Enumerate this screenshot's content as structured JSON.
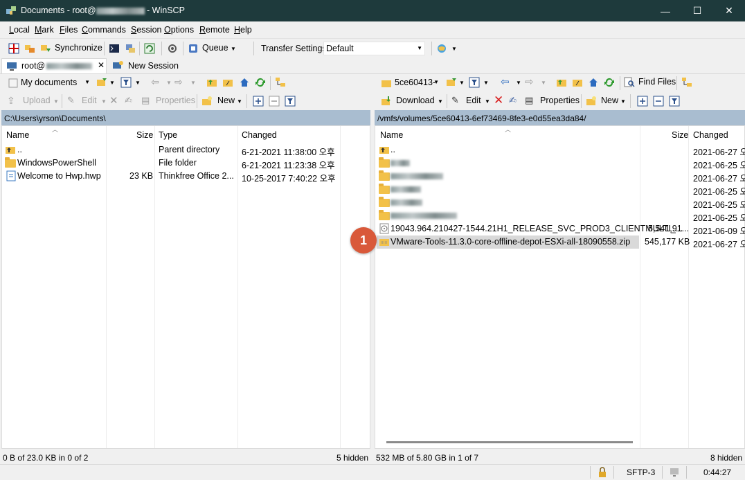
{
  "window": {
    "title_prefix": "Documents - root@",
    "title_suffix": " - WinSCP",
    "minimize_glyph": "—",
    "maximize_glyph": "☐",
    "close_glyph": "✕"
  },
  "menu": {
    "items": [
      {
        "underline": "L",
        "rest": "ocal"
      },
      {
        "underline": "M",
        "rest": "ark"
      },
      {
        "underline": "F",
        "rest": "iles"
      },
      {
        "underline": "C",
        "rest": "ommands"
      },
      {
        "underline": "S",
        "rest": "ession"
      },
      {
        "underline": "O",
        "rest": "ptions"
      },
      {
        "underline": "R",
        "rest": "emote"
      },
      {
        "underline": "H",
        "rest": "elp"
      }
    ]
  },
  "toolbar": {
    "synchronize_label": "Synchronize",
    "queue_label": "Queue",
    "transfer_settings_label": "Transfer Settings",
    "transfer_settings_value": "Default"
  },
  "tabs": {
    "session_tab_prefix": "root@",
    "new_session_label": "New Session"
  },
  "left_panel": {
    "location_combo": "My documents",
    "upload_label": "Upload",
    "edit_label": "Edit",
    "properties_label": "Properties",
    "new_label": "New",
    "path": "C:\\Users\\yrson\\Documents\\",
    "columns": {
      "name": "Name",
      "size": "Size",
      "type": "Type",
      "changed": "Changed"
    },
    "rows": [
      {
        "name": "..",
        "size": "",
        "type": "Parent directory",
        "changed": "6-21-2021  11:38:00 오후",
        "icon": "parent-folder-icon"
      },
      {
        "name": "WindowsPowerShell",
        "size": "",
        "type": "File folder",
        "changed": "6-21-2021  11:23:38 오후",
        "icon": "folder-icon"
      },
      {
        "name": "Welcome to Hwp.hwp",
        "size": "23 KB",
        "type": "Thinkfree Office 2...",
        "changed": "10-25-2017  7:40:22 오후",
        "icon": "document-icon"
      }
    ],
    "status": "0 B of 23.0 KB in 0 of 2",
    "hidden": "5 hidden"
  },
  "right_panel": {
    "location_combo": "5ce60413-",
    "download_label": "Download",
    "edit_label": "Edit",
    "properties_label": "Properties",
    "new_label": "New",
    "find_files_label": "Find Files",
    "path": "/vmfs/volumes/5ce60413-6ef73469-8fe3-e0d55ea3da84/",
    "columns": {
      "name": "Name",
      "size": "Size",
      "changed": "Changed"
    },
    "rows": [
      {
        "name": "..",
        "size": "",
        "changed": "2021-06-27 오",
        "icon": "parent-folder-icon",
        "blurred": false
      },
      {
        "name": "",
        "size": "",
        "changed": "2021-06-25 오",
        "icon": "folder-icon",
        "blurred": true
      },
      {
        "name": "",
        "size": "",
        "changed": "2021-06-27 오",
        "icon": "folder-icon",
        "blurred": true
      },
      {
        "name": "",
        "size": "",
        "changed": "2021-06-25 오",
        "icon": "folder-icon",
        "blurred": true
      },
      {
        "name": "",
        "size": "",
        "changed": "2021-06-25 오",
        "icon": "folder-icon",
        "blurred": true
      },
      {
        "name": "",
        "size": "",
        "changed": "2021-06-25 오",
        "icon": "folder-icon",
        "blurred": true
      },
      {
        "name": "19043.964.210427-1544.21H1_RELEASE_SVC_PROD3_CLIENTMULTI_...",
        "size": "5,541,91...",
        "changed": "2021-06-09 오",
        "icon": "disc-image-icon",
        "blurred": false
      },
      {
        "name": "VMware-Tools-11.3.0-core-offline-depot-ESXi-all-18090558.zip",
        "size": "545,177 KB",
        "changed": "2021-06-27 오",
        "icon": "zip-icon",
        "blurred": false,
        "selected": true
      }
    ],
    "status": "532 MB of 5.80 GB in 1 of 7",
    "hidden": "8 hidden"
  },
  "annotation": {
    "badge_number": "1"
  },
  "bottom": {
    "protocol": "SFTP-3",
    "elapsed": "0:44:27"
  }
}
